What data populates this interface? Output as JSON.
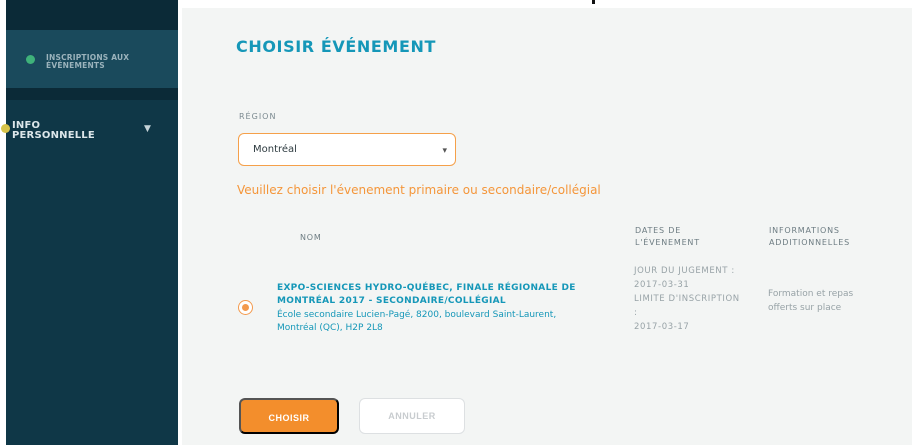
{
  "sidebar": {
    "items": [
      {
        "label": "INSCRIPTIONS AUX ÉVÉNEMENTS",
        "dot_color": "#3fb27a"
      },
      {
        "label": "INFO PERSONNELLE",
        "dot_color": "#d8c44a",
        "caret": "▼"
      }
    ]
  },
  "main": {
    "title": "CHOISIR ÉVÉNEMENT",
    "region": {
      "label": "RÉGION",
      "selected": "Montréal",
      "caret": "▾"
    },
    "instruction": "Veuillez choisir l'évenement primaire ou secondaire/collégial",
    "table": {
      "headers": {
        "nom": "NOM",
        "dates": "DATES DE L'ÉVENEMENT",
        "info": "INFORMATIONS ADDITIONNELLES"
      },
      "rows": [
        {
          "selected": true,
          "title": "EXPO-SCIENCES HYDRO-QUÉBEC, FINALE RÉGIONALE DE MONTRÉAL 2017 - SECONDAIRE/COLLÉGIAL",
          "address": "École secondaire Lucien-Pagé, 8200, boulevard Saint-Laurent, Montréal (QC), H2P 2L8",
          "judging_label": "JOUR DU JUGEMENT :",
          "judging_date": "2017-03-31",
          "deadline_label": "LIMITE D'INSCRIPTION :",
          "deadline_date": "2017-03-17",
          "info": "Formation et repas offerts sur place"
        }
      ]
    },
    "buttons": {
      "choose": "CHOISIR",
      "cancel": "ANNULER"
    }
  },
  "colors": {
    "accent_orange": "#f38e2c",
    "title_blue": "#1597b8",
    "sidebar_bg": "#0f3747"
  }
}
